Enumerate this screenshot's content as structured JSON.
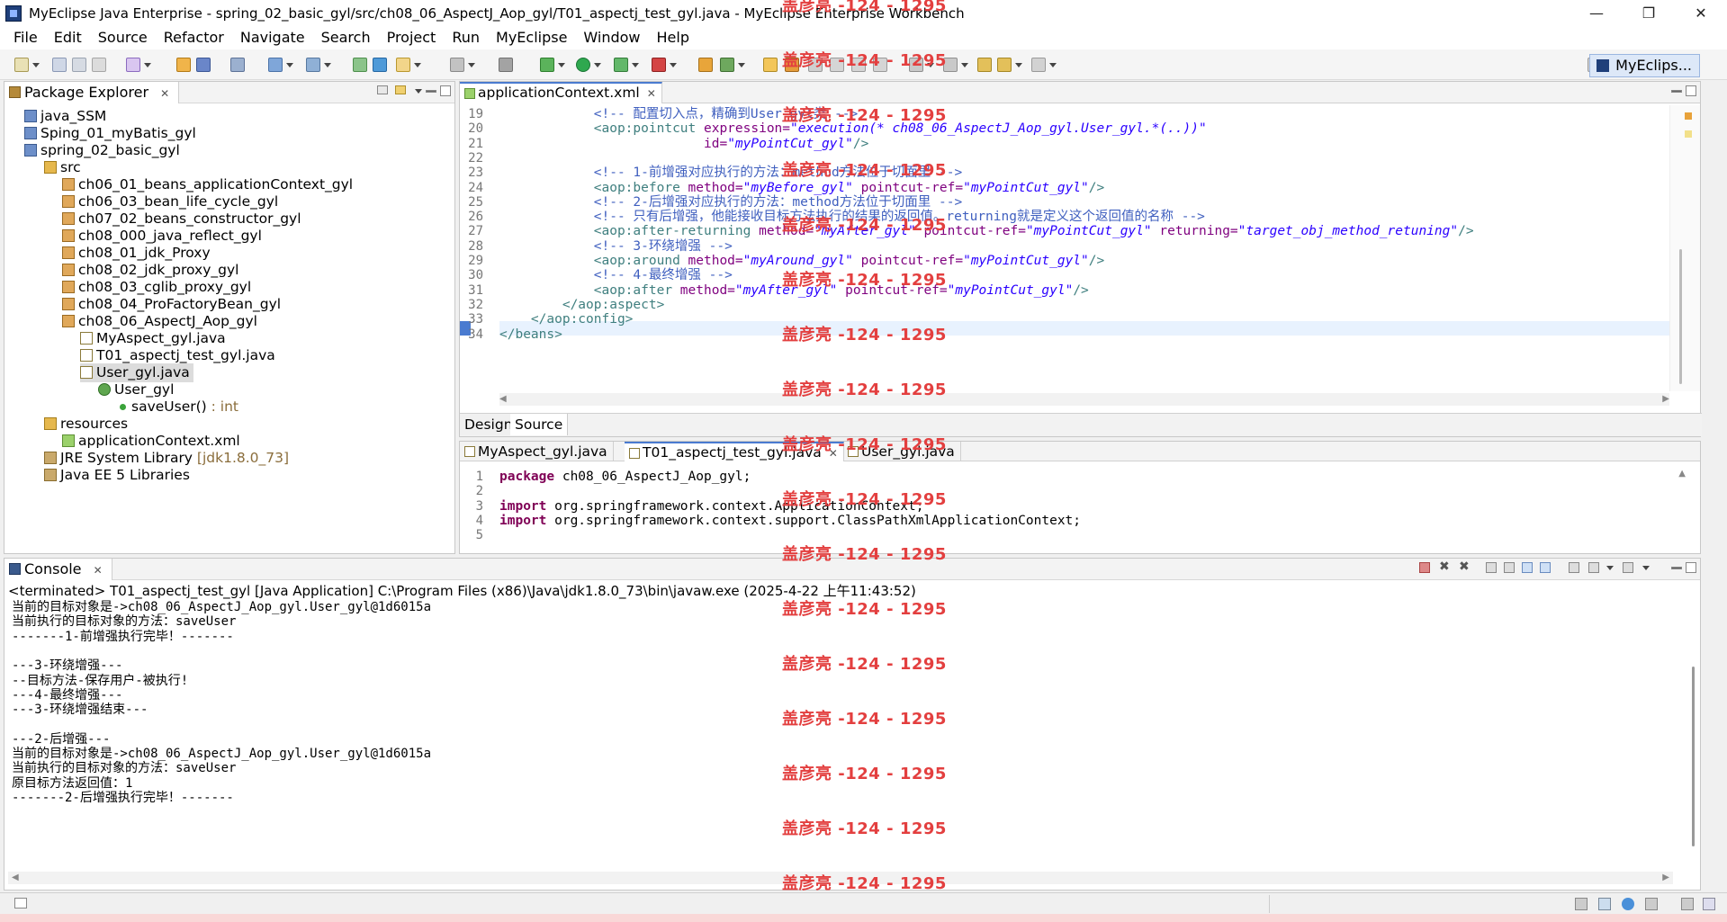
{
  "window": {
    "title": "MyEclipse Java Enterprise - spring_02_basic_gyl/src/ch08_06_AspectJ_Aop_gyl/T01_aspectj_test_gyl.java - MyEclipse Enterprise Workbench",
    "minimize": "—",
    "maximize": "❐",
    "close": "✕"
  },
  "menu": [
    "File",
    "Edit",
    "Source",
    "Refactor",
    "Navigate",
    "Search",
    "Project",
    "Run",
    "MyEclipse",
    "Window",
    "Help"
  ],
  "perspective": "MyEclips...",
  "package_explorer": {
    "title": "Package Explorer",
    "items": [
      {
        "label": "java_SSM",
        "suffix": ""
      },
      {
        "label": "Sping_01_myBatis_gyl",
        "suffix": ""
      },
      {
        "label": "spring_02_basic_gyl",
        "suffix": ""
      },
      {
        "label": "src",
        "suffix": ""
      },
      {
        "label": "ch06_01_beans_applicationContext_gyl",
        "suffix": ""
      },
      {
        "label": "ch06_03_bean_life_cycle_gyl",
        "suffix": ""
      },
      {
        "label": "ch07_02_beans_constructor_gyl",
        "suffix": ""
      },
      {
        "label": "ch08_000_java_reflect_gyl",
        "suffix": ""
      },
      {
        "label": "ch08_01_jdk_Proxy",
        "suffix": ""
      },
      {
        "label": "ch08_02_jdk_proxy_gyl",
        "suffix": ""
      },
      {
        "label": "ch08_03_cglib_proxy_gyl",
        "suffix": ""
      },
      {
        "label": "ch08_04_ProFactoryBean_gyl",
        "suffix": ""
      },
      {
        "label": "ch08_06_AspectJ_Aop_gyl",
        "suffix": ""
      },
      {
        "label": "MyAspect_gyl.java",
        "suffix": ""
      },
      {
        "label": "T01_aspectj_test_gyl.java",
        "suffix": ""
      },
      {
        "label": "User_gyl.java",
        "suffix": ""
      },
      {
        "label": "User_gyl",
        "suffix": ""
      },
      {
        "label": "saveUser()",
        "suffix": " : int"
      },
      {
        "label": "resources",
        "suffix": ""
      },
      {
        "label": "applicationContext.xml",
        "suffix": ""
      },
      {
        "label": "JRE System Library",
        "suffix": " [jdk1.8.0_73]"
      },
      {
        "label": "Java EE 5 Libraries",
        "suffix": ""
      }
    ]
  },
  "xml_editor": {
    "tab": "applicationContext.xml",
    "design_tab": "Design",
    "source_tab": "Source",
    "lines": [
      {
        "n": "19",
        "parts": [
          {
            "t": "            ",
            "c": "plain"
          },
          {
            "t": "<!-- 配置切入点，精确到User_gyl类 -->",
            "c": "com"
          }
        ]
      },
      {
        "n": "20",
        "parts": [
          {
            "t": "            ",
            "c": "plain"
          },
          {
            "t": "<aop:pointcut ",
            "c": "tag"
          },
          {
            "t": "expression=",
            "c": "attr"
          },
          {
            "t": "\"execution(* ch08_06_AspectJ_Aop_gyl.User_gyl.*(..))\"",
            "c": "val"
          }
        ]
      },
      {
        "n": "21",
        "parts": [
          {
            "t": "                          ",
            "c": "plain"
          },
          {
            "t": "id=",
            "c": "attr"
          },
          {
            "t": "\"myPointCut_gyl\"",
            "c": "val"
          },
          {
            "t": "/>",
            "c": "tag"
          }
        ]
      },
      {
        "n": "22",
        "parts": [
          {
            "t": "",
            "c": "plain"
          }
        ]
      },
      {
        "n": "23",
        "parts": [
          {
            "t": "            ",
            "c": "plain"
          },
          {
            "t": "<!-- 1-前增强对应执行的方法：method方法位于切面里 -->",
            "c": "com"
          }
        ]
      },
      {
        "n": "24",
        "parts": [
          {
            "t": "            ",
            "c": "plain"
          },
          {
            "t": "<aop:before ",
            "c": "tag"
          },
          {
            "t": "method=",
            "c": "attr"
          },
          {
            "t": "\"myBefore_gyl\"",
            "c": "val"
          },
          {
            "t": " ",
            "c": "plain"
          },
          {
            "t": "pointcut-ref=",
            "c": "attr"
          },
          {
            "t": "\"myPointCut_gyl\"",
            "c": "val"
          },
          {
            "t": "/>",
            "c": "tag"
          }
        ]
      },
      {
        "n": "25",
        "parts": [
          {
            "t": "            ",
            "c": "plain"
          },
          {
            "t": "<!-- 2-后增强对应执行的方法：method方法位于切面里 -->",
            "c": "com"
          }
        ]
      },
      {
        "n": "26",
        "parts": [
          {
            "t": "            ",
            "c": "plain"
          },
          {
            "t": "<!-- 只有后增强，他能接收目标方法执行的结果的返回值。returning就是定义这个返回值的名称 -->",
            "c": "com"
          }
        ]
      },
      {
        "n": "27",
        "parts": [
          {
            "t": "            ",
            "c": "plain"
          },
          {
            "t": "<aop:after-returning ",
            "c": "tag"
          },
          {
            "t": "method=",
            "c": "attr"
          },
          {
            "t": "\"myAfter_gyl\"",
            "c": "val"
          },
          {
            "t": " ",
            "c": "plain"
          },
          {
            "t": "pointcut-ref=",
            "c": "attr"
          },
          {
            "t": "\"myPointCut_gyl\"",
            "c": "val"
          },
          {
            "t": " ",
            "c": "plain"
          },
          {
            "t": "returning=",
            "c": "attr"
          },
          {
            "t": "\"target_obj_method_retuning\"",
            "c": "val"
          },
          {
            "t": "/>",
            "c": "tag"
          }
        ]
      },
      {
        "n": "28",
        "parts": [
          {
            "t": "            ",
            "c": "plain"
          },
          {
            "t": "<!-- 3-环绕增强 -->",
            "c": "com"
          }
        ]
      },
      {
        "n": "29",
        "parts": [
          {
            "t": "            ",
            "c": "plain"
          },
          {
            "t": "<aop:around ",
            "c": "tag"
          },
          {
            "t": "method=",
            "c": "attr"
          },
          {
            "t": "\"myAround_gyl\"",
            "c": "val"
          },
          {
            "t": " ",
            "c": "plain"
          },
          {
            "t": "pointcut-ref=",
            "c": "attr"
          },
          {
            "t": "\"myPointCut_gyl\"",
            "c": "val"
          },
          {
            "t": "/>",
            "c": "tag"
          }
        ]
      },
      {
        "n": "30",
        "parts": [
          {
            "t": "            ",
            "c": "plain"
          },
          {
            "t": "<!-- 4-最终增强 -->",
            "c": "com"
          }
        ]
      },
      {
        "n": "31",
        "parts": [
          {
            "t": "            ",
            "c": "plain"
          },
          {
            "t": "<aop:after ",
            "c": "tag"
          },
          {
            "t": "method=",
            "c": "attr"
          },
          {
            "t": "\"myAfter_gyl\"",
            "c": "val"
          },
          {
            "t": " ",
            "c": "plain"
          },
          {
            "t": "pointcut-ref=",
            "c": "attr"
          },
          {
            "t": "\"myPointCut_gyl\"",
            "c": "val"
          },
          {
            "t": "/>",
            "c": "tag"
          }
        ]
      },
      {
        "n": "32",
        "parts": [
          {
            "t": "        ",
            "c": "plain"
          },
          {
            "t": "</aop:aspect>",
            "c": "tag"
          }
        ]
      },
      {
        "n": "33",
        "parts": [
          {
            "t": "    ",
            "c": "plain"
          },
          {
            "t": "</aop:config>",
            "c": "tag"
          }
        ]
      },
      {
        "n": "34",
        "parts": [
          {
            "t": "</beans>",
            "c": "tag"
          }
        ]
      }
    ]
  },
  "java_editor": {
    "tabs": [
      "MyAspect_gyl.java",
      "T01_aspectj_test_gyl.java",
      "User_gyl.java"
    ],
    "lines": [
      {
        "n": "1",
        "parts": [
          {
            "t": "package",
            "c": "kw"
          },
          {
            "t": " ch08_06_AspectJ_Aop_gyl;",
            "c": "plain"
          }
        ]
      },
      {
        "n": "2",
        "parts": [
          {
            "t": "",
            "c": "plain"
          }
        ]
      },
      {
        "n": "3",
        "parts": [
          {
            "t": "import",
            "c": "kw"
          },
          {
            "t": " org.springframework.context.ApplicationContext;",
            "c": "plain"
          }
        ]
      },
      {
        "n": "4",
        "parts": [
          {
            "t": "import",
            "c": "kw"
          },
          {
            "t": " org.springframework.context.support.ClassPathXmlApplicationContext;",
            "c": "plain"
          }
        ]
      },
      {
        "n": "5",
        "parts": [
          {
            "t": "",
            "c": "plain"
          }
        ]
      }
    ]
  },
  "console": {
    "title": "Console",
    "header": "<terminated> T01_aspectj_test_gyl [Java Application] C:\\Program Files (x86)\\Java\\jdk1.8.0_73\\bin\\javaw.exe (2025-4-22 上午11:43:52)",
    "lines": [
      "当前的目标对象是->ch08_06_AspectJ_Aop_gyl.User_gyl@1d6015a",
      "当前执行的目标对象的方法：saveUser",
      "-------1-前增强执行完毕！-------",
      "",
      "---3-环绕增强---",
      "--目标方法-保存用户-被执行!",
      "---4-最终增强---",
      "---3-环绕增强结束---",
      "",
      "---2-后增强---",
      "当前的目标对象是->ch08_06_AspectJ_Aop_gyl.User_gyl@1d6015a",
      "当前执行的目标对象的方法：saveUser",
      "原目标方法返回值：1",
      "-------2-后增强执行完毕！-------"
    ]
  },
  "watermark": "盖彦亮 -124 - 1295",
  "colors": {
    "keyword": "#7f0055",
    "comment": "#3f5fbf",
    "attr": "#7f007f",
    "value": "#2a00ff",
    "tag": "#3f7f7f",
    "watermark": "#e33f3f"
  }
}
